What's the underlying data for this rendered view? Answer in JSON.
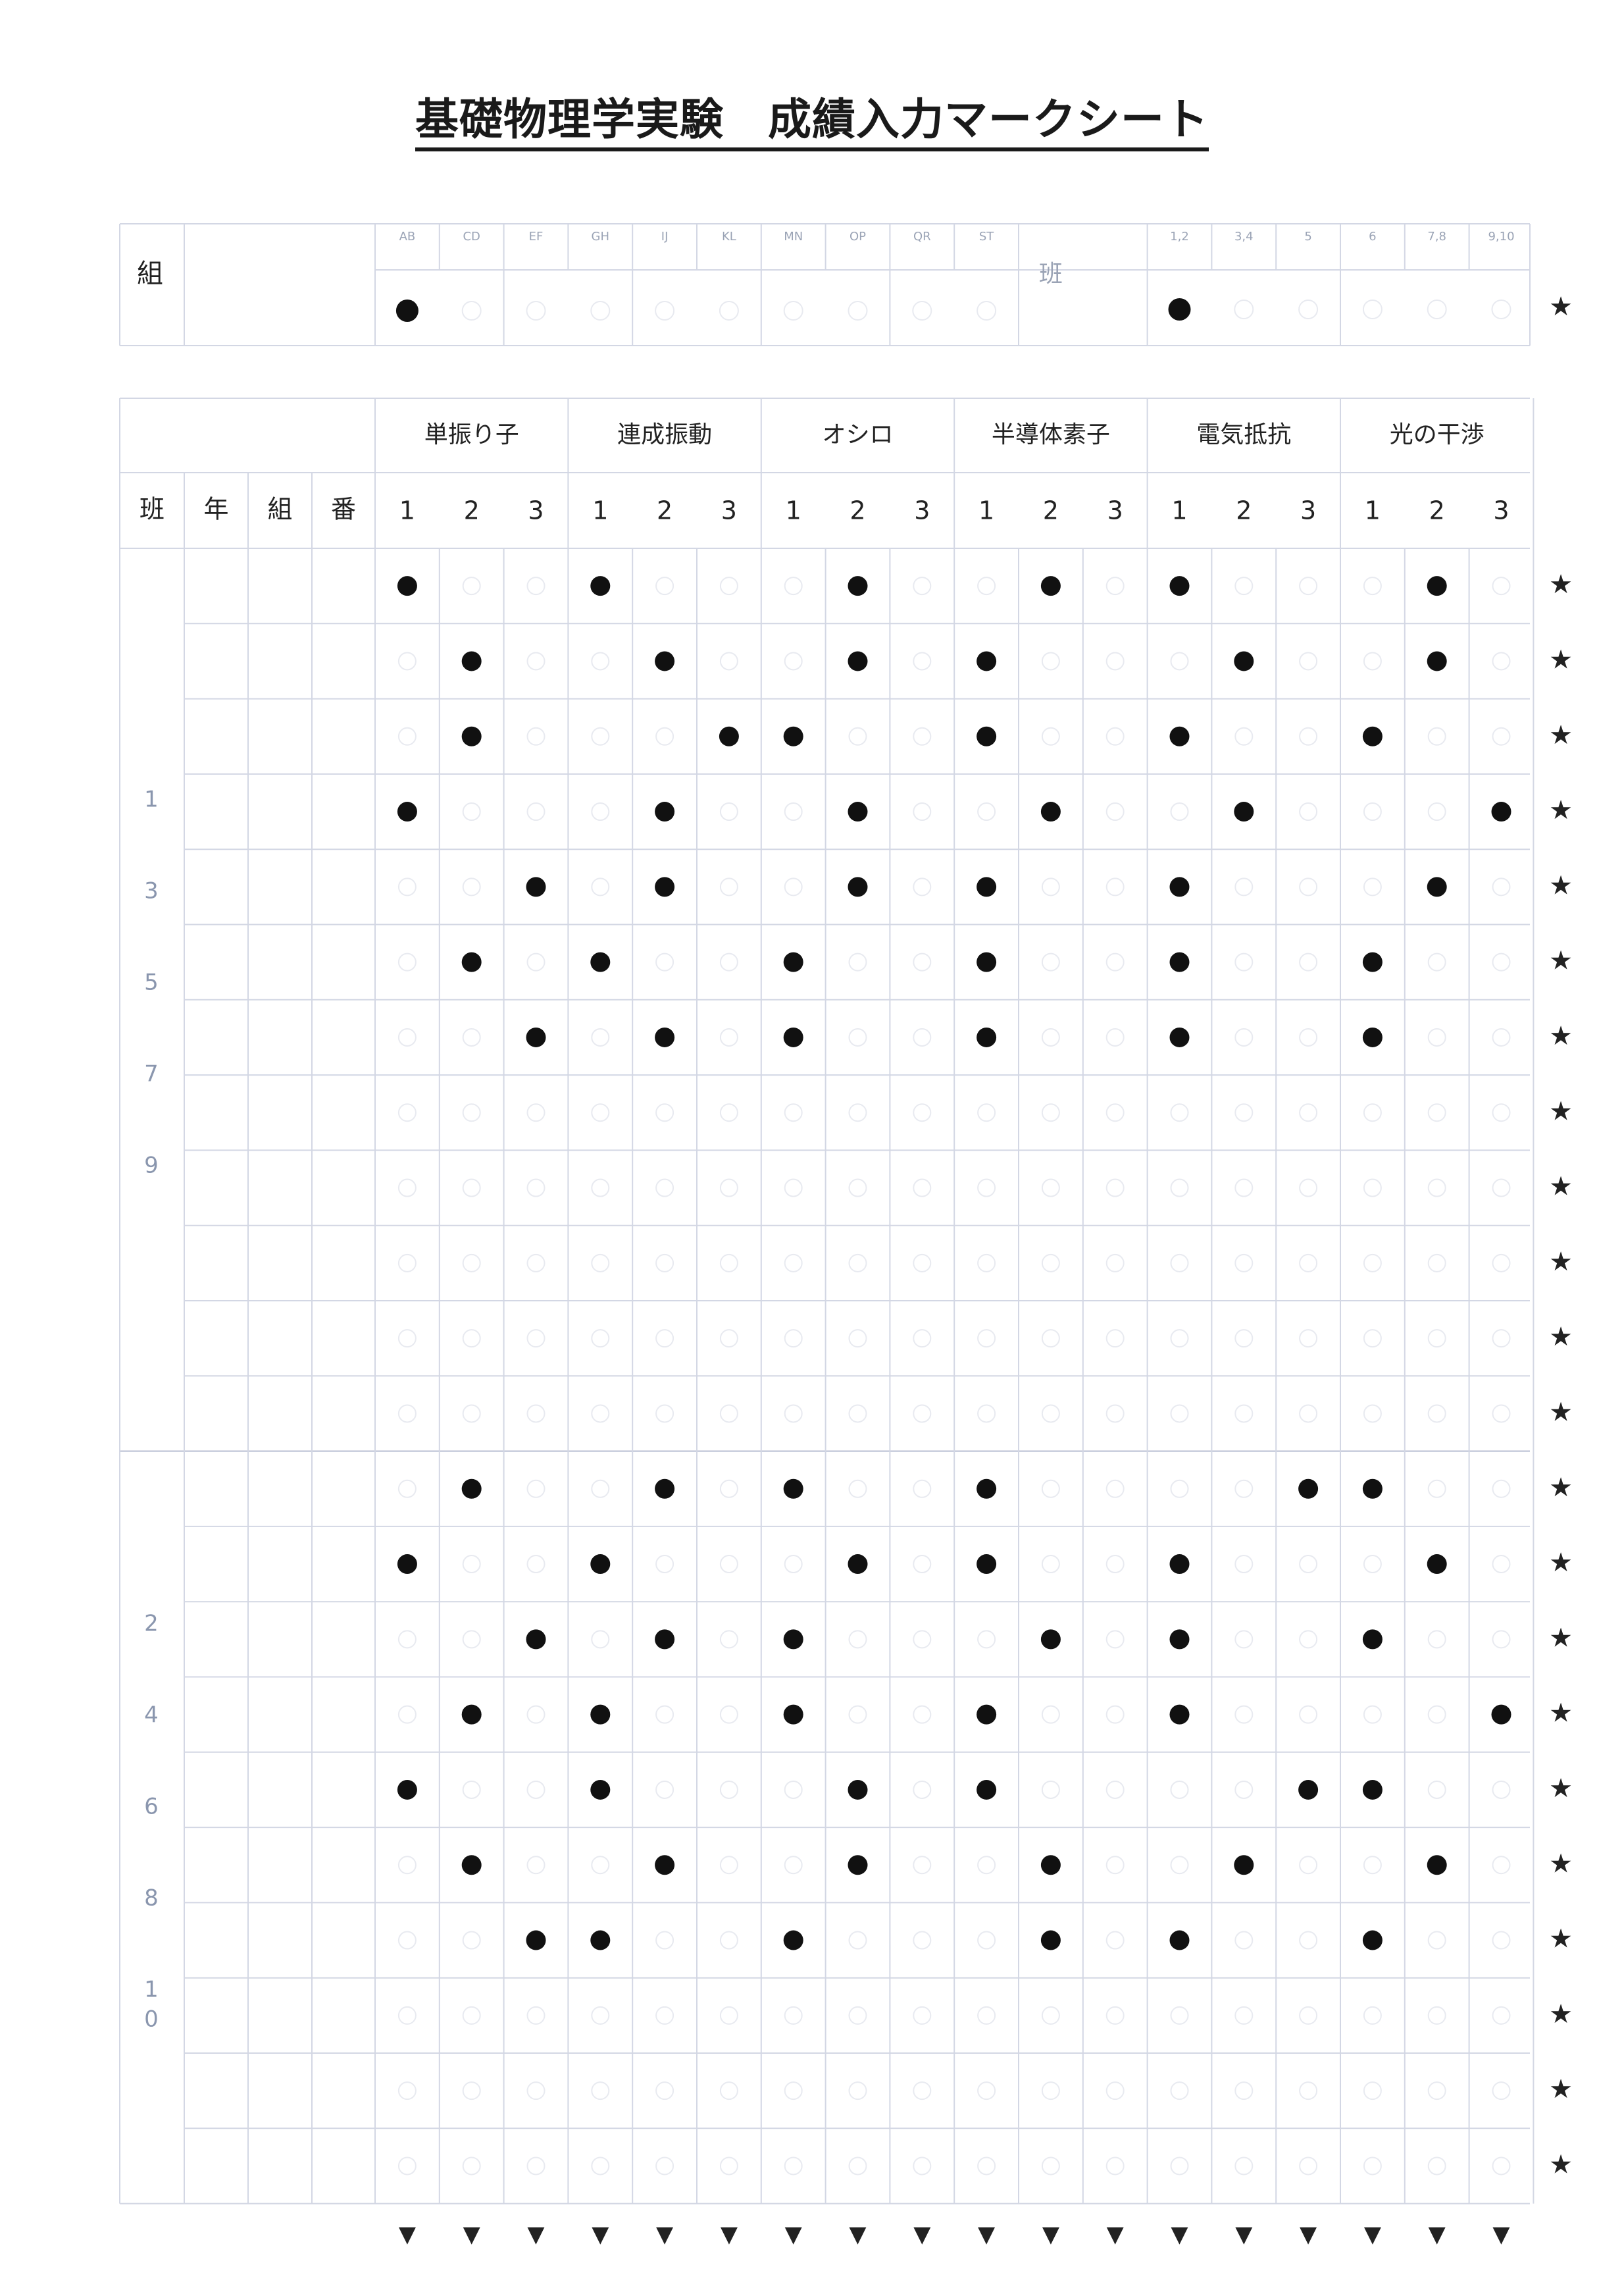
{
  "title": "基礎物理学実験　成績入力マークシート",
  "top_section": {
    "kumi_label": "組",
    "han_label": "班",
    "kumi_options": [
      "AB",
      "CD",
      "EF",
      "GH",
      "IJ",
      "KL",
      "MN",
      "OP",
      "QR",
      "ST"
    ],
    "han_options": [
      "1,2",
      "3,4",
      "5",
      "6",
      "7,8",
      "9,10"
    ],
    "kumi_marked_index": 0,
    "han_marked_index": 0
  },
  "header": {
    "left_columns": [
      "班",
      "年",
      "組",
      "番"
    ],
    "experiments": [
      "単振り子",
      "連成振動",
      "オシロ",
      "半導体素子",
      "電気抵抗",
      "光の干渉"
    ],
    "grades": [
      "1",
      "2",
      "3"
    ]
  },
  "block1": {
    "side_labels": [
      "1",
      "3",
      "5",
      "7",
      "9"
    ],
    "rows": [
      [
        1,
        1,
        2,
        2,
        1,
        2
      ],
      [
        2,
        2,
        2,
        1,
        2,
        2
      ],
      [
        2,
        3,
        1,
        1,
        1,
        1
      ],
      [
        1,
        2,
        2,
        2,
        2,
        3
      ],
      [
        3,
        2,
        2,
        1,
        1,
        2
      ],
      [
        2,
        1,
        1,
        1,
        1,
        1
      ],
      [
        3,
        2,
        1,
        1,
        1,
        1
      ],
      [
        0,
        0,
        0,
        0,
        0,
        0
      ],
      [
        0,
        0,
        0,
        0,
        0,
        0
      ],
      [
        0,
        0,
        0,
        0,
        0,
        0
      ],
      [
        0,
        0,
        0,
        0,
        0,
        0
      ],
      [
        0,
        0,
        0,
        0,
        0,
        0
      ]
    ]
  },
  "block2": {
    "side_labels": [
      "2",
      "4",
      "6",
      "8",
      "1",
      "0"
    ],
    "rows": [
      [
        2,
        2,
        1,
        1,
        3,
        1
      ],
      [
        1,
        1,
        2,
        1,
        1,
        2
      ],
      [
        3,
        2,
        1,
        2,
        1,
        1
      ],
      [
        2,
        1,
        1,
        1,
        1,
        3
      ],
      [
        1,
        1,
        2,
        1,
        3,
        1
      ],
      [
        2,
        2,
        2,
        2,
        2,
        2
      ],
      [
        3,
        1,
        1,
        2,
        1,
        1
      ],
      [
        0,
        0,
        0,
        0,
        0,
        0
      ],
      [
        0,
        0,
        0,
        0,
        0,
        0
      ],
      [
        0,
        0,
        0,
        0,
        0,
        0
      ]
    ]
  },
  "row_marker": "★",
  "column_marker": "▼",
  "colors": {
    "grid": "#d3d7e4",
    "mark": "#111111",
    "side_text": "#8a96ae"
  }
}
